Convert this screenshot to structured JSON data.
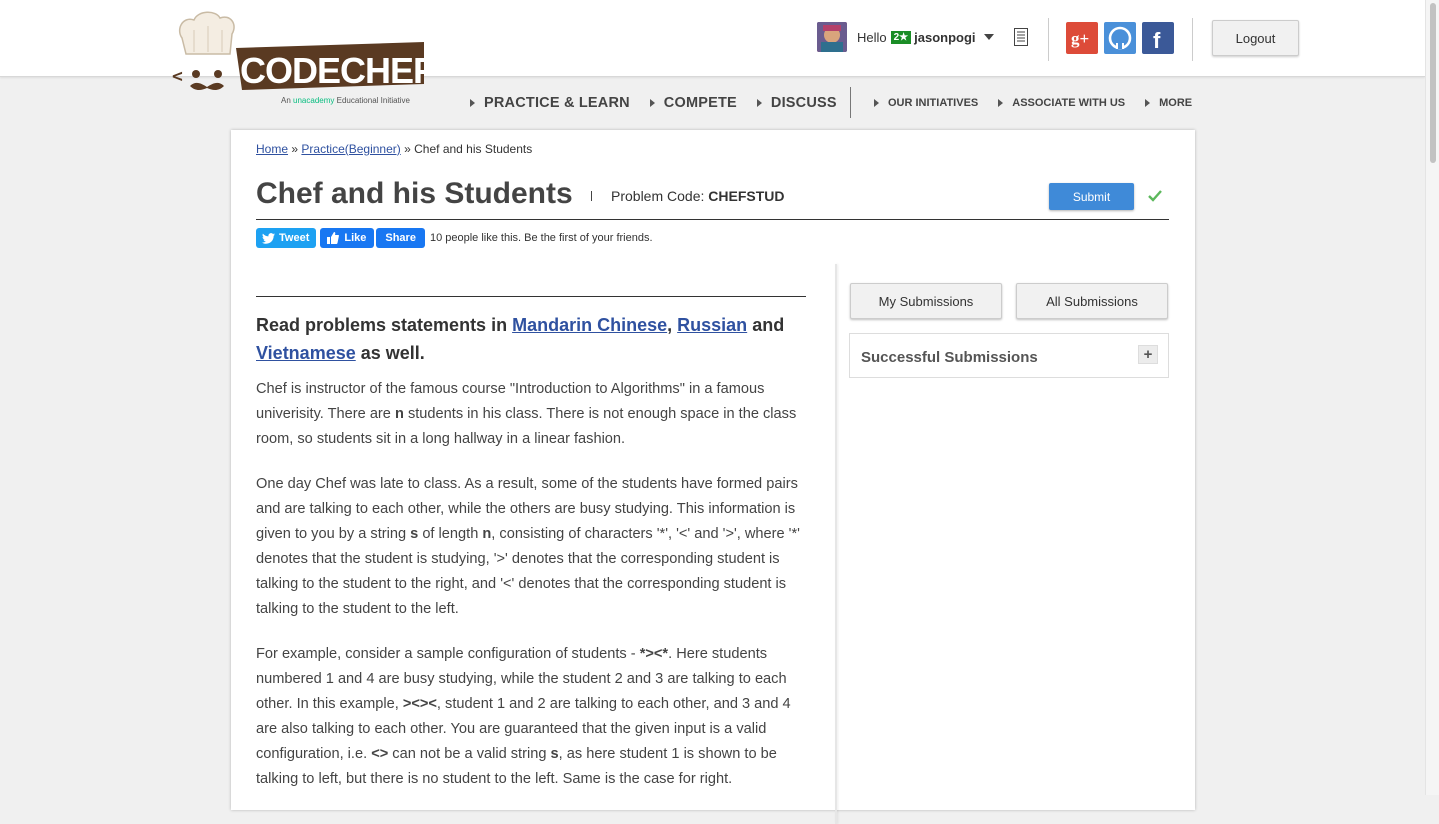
{
  "header": {
    "logo_text": "CODECHEF",
    "logo_tagline_prefix": "An",
    "logo_tagline_brand": "unacademy",
    "logo_tagline_suffix": "Educational Initiative",
    "greeting": "Hello",
    "rating_badge": "2★",
    "username": "jasonpogi",
    "logout_label": "Logout",
    "social_icons": [
      "google-plus-icon",
      "github-icon",
      "facebook-icon"
    ]
  },
  "nav": {
    "main": [
      "PRACTICE & LEARN",
      "COMPETE",
      "DISCUSS"
    ],
    "secondary": [
      "OUR INITIATIVES",
      "ASSOCIATE WITH US",
      "MORE"
    ]
  },
  "breadcrumb": {
    "home": "Home",
    "practice": "Practice(Beginner)",
    "current": "Chef and his Students",
    "separator": "»"
  },
  "problem": {
    "title": "Chef and his Students",
    "code_label": "Problem Code:",
    "code": "CHEFSTUD",
    "submit_label": "Submit"
  },
  "social_row": {
    "tweet_label": "Tweet",
    "like_label": "Like",
    "share_label": "Share",
    "like_text": "10 people like this. Be the first of your friends."
  },
  "statement": {
    "read_prefix": "Read problems statements in",
    "lang1": "Mandarin Chinese",
    "comma": ",",
    "lang2": "Russian",
    "and": "and",
    "lang3": "Vietnamese",
    "suffix": "as well.",
    "p1": {
      "a": "Chef is instructor of the famous course \"Introduction to Algorithms\" in a famous univerisity. There are ",
      "n": "n",
      "b": " students in his class. There is not enough space in the class room, so students sit in a long hallway in a linear fashion."
    },
    "p2": {
      "a": "One day Chef was late to class. As a result, some of the students have formed pairs and are talking to each other, while the others are busy studying. This information is given to you by a string ",
      "s": "s",
      "b": " of length ",
      "n": "n",
      "c": ", consisting of characters '*', '<' and '>', where '*' denotes that the student is studying, '>' denotes that the corresponding student is talking to the student to the right, and '<' denotes that the corresponding student is talking to the student to the left."
    },
    "p3": {
      "a": "For example, consider a sample configuration of students - ",
      "ex1": "*><*",
      "b": ". Here students numbered 1 and 4 are busy studying, while the student 2 and 3 are talking to each other. In this example, ",
      "ex2": "><><",
      "c": ", student 1 and 2 are talking to each other, and 3 and 4 are also talking to each other. You are guaranteed that the given input is a valid configuration, i.e. ",
      "ex3": "<>",
      "d": " can not be a valid string ",
      "s": "s",
      "e": ", as here student 1 is shown to be talking to left, but there is no student to the left. Same is the case for right."
    }
  },
  "sidebar": {
    "my_submissions": "My Submissions",
    "all_submissions": "All Submissions",
    "successful_title": "Successful Submissions",
    "expand_symbol": "+"
  },
  "colors": {
    "link": "#2f51a0",
    "submit": "#3f8ad8",
    "check": "#5cb85c",
    "badge": "#1a8d26"
  }
}
